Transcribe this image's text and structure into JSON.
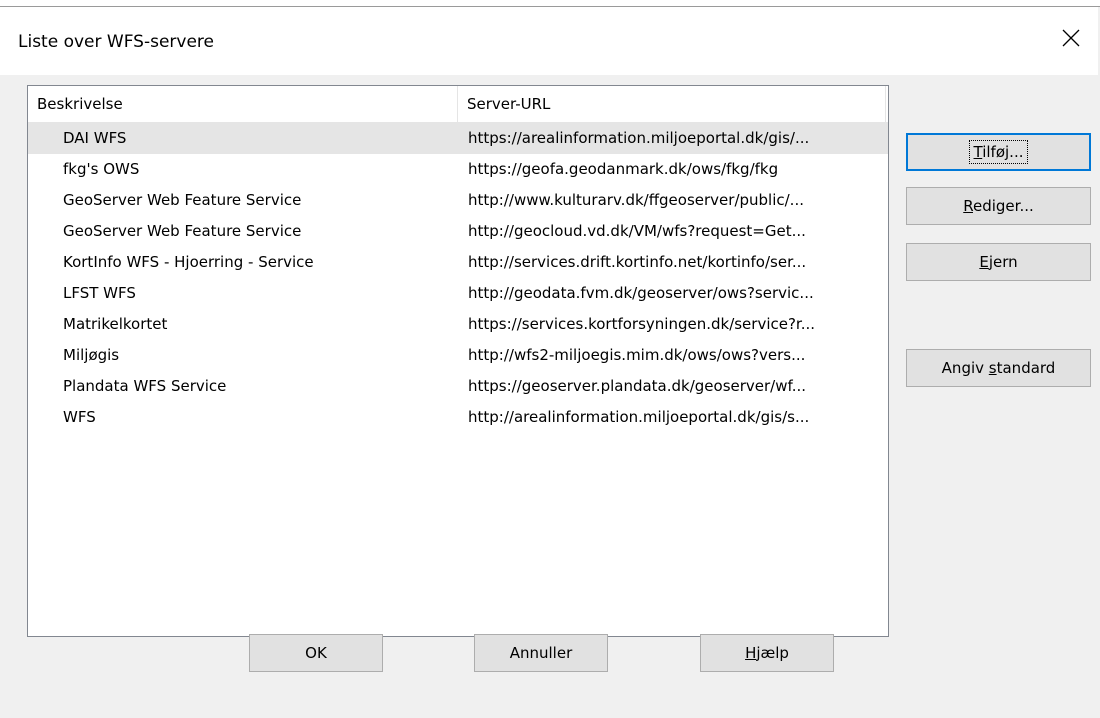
{
  "dialog": {
    "title": "Liste over WFS-servere"
  },
  "list": {
    "columns": {
      "description": "Beskrivelse",
      "url": "Server-URL"
    },
    "rows": [
      {
        "description": "DAI WFS",
        "url": "https://arealinformation.miljoeportal.dk/gis/..."
      },
      {
        "description": "fkg's OWS",
        "url": "https://geofa.geodanmark.dk/ows/fkg/fkg"
      },
      {
        "description": "GeoServer Web Feature Service",
        "url": "http://www.kulturarv.dk/ffgeoserver/public/..."
      },
      {
        "description": "GeoServer Web Feature Service",
        "url": "http://geocloud.vd.dk/VM/wfs?request=Get..."
      },
      {
        "description": "KortInfo WFS - Hjoerring - Service",
        "url": "http://services.drift.kortinfo.net/kortinfo/ser..."
      },
      {
        "description": "LFST WFS",
        "url": "http://geodata.fvm.dk/geoserver/ows?servic..."
      },
      {
        "description": "Matrikelkortet",
        "url": "https://services.kortforsyningen.dk/service?r..."
      },
      {
        "description": "Miljøgis",
        "url": "http://wfs2-miljoegis.mim.dk/ows/ows?vers..."
      },
      {
        "description": "Plandata WFS Service",
        "url": "https://geoserver.plandata.dk/geoserver/wf..."
      },
      {
        "description": "WFS",
        "url": "http://arealinformation.miljoeportal.dk/gis/s..."
      }
    ]
  },
  "side_buttons": {
    "add": {
      "mnemonic": "T",
      "rest": "ilføj..."
    },
    "edit": {
      "mnemonic": "R",
      "rest": "ediger..."
    },
    "remove": {
      "mnemonic": "E",
      "rest": "jern"
    },
    "set_default": {
      "pre": "Angiv ",
      "mnemonic": "s",
      "rest": "tandard"
    }
  },
  "bottom_buttons": {
    "ok": "OK",
    "cancel": "Annuller",
    "help": {
      "mnemonic": "H",
      "rest": "jælp"
    }
  },
  "icons": {
    "close": "close-icon"
  },
  "colors": {
    "accent": "#0078d7",
    "selection": "#e5e5e5",
    "button": "#e1e1e1"
  }
}
